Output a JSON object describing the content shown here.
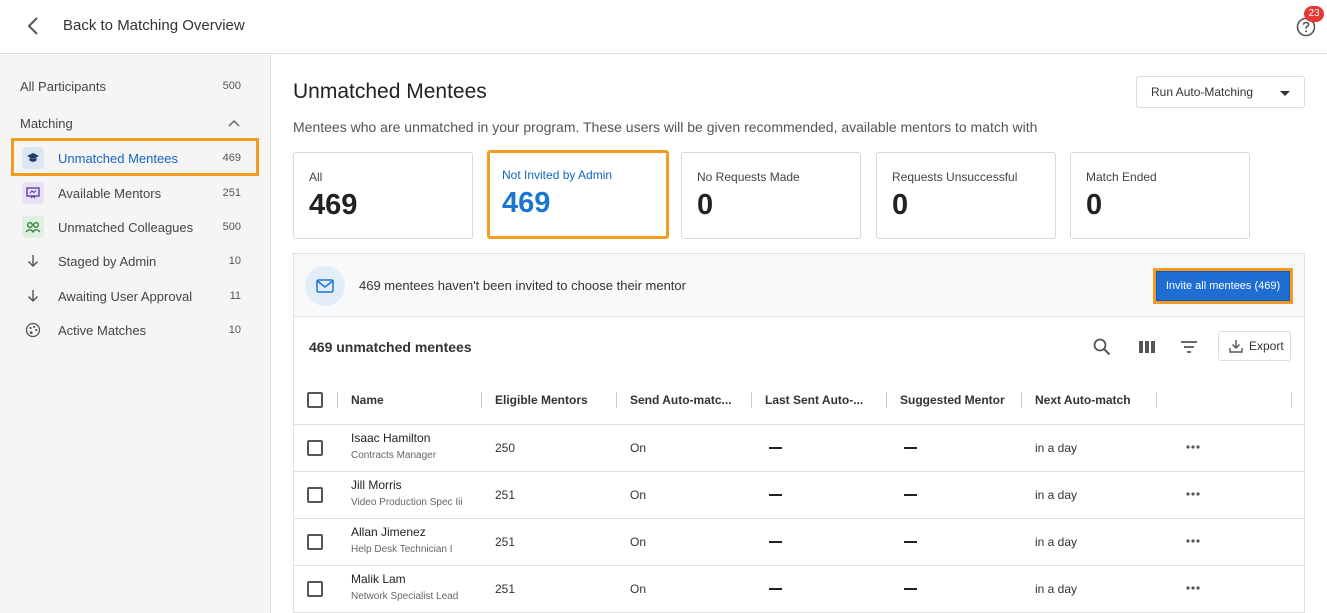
{
  "header": {
    "back_label": "Back to Matching Overview",
    "help_badge": "23"
  },
  "sidebar": {
    "all_participants": {
      "label": "All Participants",
      "count": "500"
    },
    "section_label": "Matching",
    "items": [
      {
        "label": "Unmatched Mentees",
        "count": "469",
        "icon": "mortarboard-icon",
        "selected": true
      },
      {
        "label": "Available Mentors",
        "count": "251",
        "icon": "presentation-icon"
      },
      {
        "label": "Unmatched Colleagues",
        "count": "500",
        "icon": "people-icon"
      },
      {
        "label": "Staged by Admin",
        "count": "10",
        "icon": "arrow-down-icon"
      },
      {
        "label": "Awaiting User Approval",
        "count": "11",
        "icon": "arrow-down-icon"
      },
      {
        "label": "Active Matches",
        "count": "10",
        "icon": "palette-icon"
      }
    ]
  },
  "main": {
    "title": "Unmatched Mentees",
    "subtitle": "Mentees who are unmatched in your program. These users will be given recommended, available mentors to match with",
    "run_button": "Run Auto-Matching",
    "cards": [
      {
        "label": "All",
        "value": "469"
      },
      {
        "label": "Not Invited by Admin",
        "value": "469",
        "active": true
      },
      {
        "label": "No Requests Made",
        "value": "0"
      },
      {
        "label": "Requests Unsuccessful",
        "value": "0"
      },
      {
        "label": "Match Ended",
        "value": "0"
      }
    ],
    "banner": {
      "text": "469 mentees haven't been invited to choose their mentor",
      "button": "Invite all mentees (469)"
    },
    "table": {
      "title": "469 unmatched mentees",
      "export_label": "Export",
      "columns": [
        "Name",
        "Eligible Mentors",
        "Send Auto-matc...",
        "Last Sent Auto-...",
        "Suggested Mentor",
        "Next Auto-match"
      ],
      "rows": [
        {
          "name": "Isaac Hamilton",
          "title": "Contracts Manager",
          "eligible": "250",
          "send_auto": "On",
          "next": "in a day"
        },
        {
          "name": "Jill Morris",
          "title": "Video Production Spec Iii",
          "eligible": "251",
          "send_auto": "On",
          "next": "in a day"
        },
        {
          "name": "Allan Jimenez",
          "title": "Help Desk Technician I",
          "eligible": "251",
          "send_auto": "On",
          "next": "in a day"
        },
        {
          "name": "Malik Lam",
          "title": "Network Specialist Lead",
          "eligible": "251",
          "send_auto": "On",
          "next": "in a day"
        }
      ]
    }
  },
  "colors": {
    "accent_blue": "#1976d2",
    "highlight_orange": "#f39c1f",
    "badge_red": "#e53935"
  }
}
